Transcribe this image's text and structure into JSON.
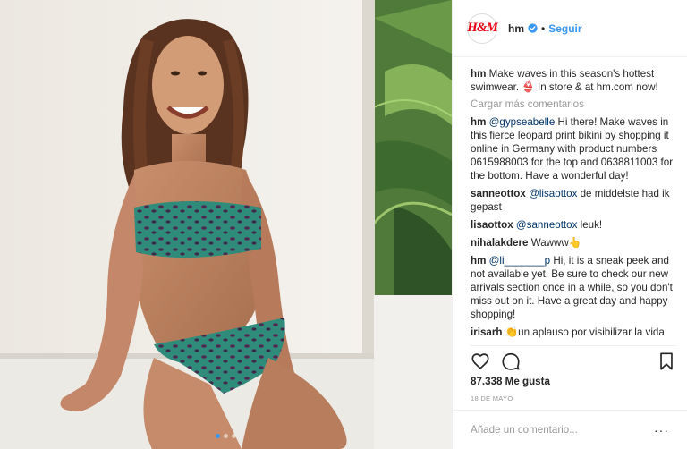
{
  "photo": {
    "icon": "post-photo",
    "carousel_count": 3,
    "carousel_active": 1
  },
  "header": {
    "avatar_text": "H&M",
    "username": "hm",
    "separator": "•",
    "follow_label": "Seguir",
    "verified_icon": "verified-badge-icon"
  },
  "caption": {
    "username": "hm",
    "text": "Make waves in this season's hottest swimwear. 👙 In store & at hm.com now!"
  },
  "load_more": "Cargar más comentarios",
  "comments": [
    {
      "user": "hm",
      "mention": "@gypseabelle",
      "text": " Hi there! Make waves in this fierce leopard print bikini by shopping it online in Germany with product numbers 0615988003 for the top and 0638811003 for the bottom. Have a wonderful day!"
    },
    {
      "user": "sanneottox",
      "mention": "@lisaottox",
      "text": " de middelste had ik gepast"
    },
    {
      "user": "lisaottox",
      "mention": "@sanneottox",
      "text": " leuk!"
    },
    {
      "user": "nihalakdere",
      "mention": "",
      "text": "Wawww👆"
    },
    {
      "user": "hm",
      "mention": "@li_______p",
      "text": " Hi, it is a sneak peek and not available yet. Be sure to check our new arrivals section once in a while, so you don't miss out on it. Have a great day and happy shopping!"
    },
    {
      "user": "irisarh",
      "mention": "",
      "text": "👏un aplauso por visibilizar la vida"
    }
  ],
  "actions": {
    "like_icon": "heart-icon",
    "comment_icon": "comment-icon",
    "save_icon": "bookmark-icon"
  },
  "likes": "87.338 Me gusta",
  "date": "18 DE MAYO",
  "add_comment": {
    "placeholder": "Añade un comentario...",
    "more": "···"
  },
  "colors": {
    "accent": "#3897f0",
    "brand": "#e50010",
    "mention": "#003569",
    "muted": "#999999"
  }
}
